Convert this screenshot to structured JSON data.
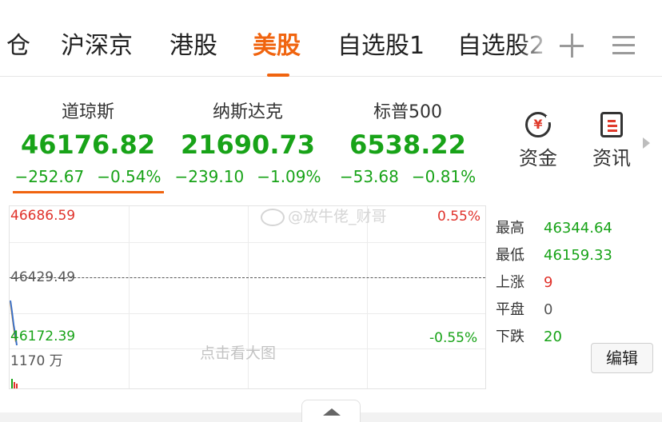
{
  "tabs": [
    {
      "label": "仓"
    },
    {
      "label": "沪深京"
    },
    {
      "label": "港股"
    },
    {
      "label": "美股"
    },
    {
      "label": "自选股1"
    },
    {
      "label": "自选股2"
    }
  ],
  "active_tab": "美股",
  "indices": [
    {
      "name": "道琼斯",
      "price": "46176.82",
      "change": "−252.67",
      "percent": "−0.54%"
    },
    {
      "name": "纳斯达克",
      "price": "21690.73",
      "change": "−239.10",
      "percent": "−1.09%"
    },
    {
      "name": "标普500",
      "price": "6538.22",
      "change": "−53.68",
      "percent": "−0.81%"
    }
  ],
  "quick": {
    "fund_label": "资金",
    "fund_glyph": "¥",
    "news_label": "资讯"
  },
  "chart": {
    "top_value": "46686.59",
    "top_pct": "0.55%",
    "mid_value": "46429.49",
    "bottom_value": "46172.39",
    "bottom_pct": "-0.55%",
    "volume_label": "1170 万",
    "hint": "点击看大图",
    "watermark": "@放牛佬_财哥"
  },
  "stats": [
    {
      "key": "最高",
      "value": "46344.64"
    },
    {
      "key": "最低",
      "value": "46159.33"
    },
    {
      "key": "上涨",
      "value": "9"
    },
    {
      "key": "平盘",
      "value": "0"
    },
    {
      "key": "下跌",
      "value": "20"
    }
  ],
  "edit_label": "编辑",
  "colors": {
    "accent": "#f0640f",
    "up": "#e0322b",
    "down": "#18a318"
  }
}
